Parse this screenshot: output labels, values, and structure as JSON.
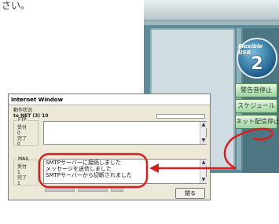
{
  "caption": "さい。",
  "background_app": {
    "logo_text": "Flexible USB",
    "logo_number": "2",
    "buttons": [
      "警告音停止",
      "スケジュール",
      "ネット配信停止"
    ]
  },
  "internet_window": {
    "title": "Internet Window",
    "status_heading": "動作状況",
    "status_line": "to NET (3)  10",
    "ftp": {
      "legend": "FTP",
      "sent_label": "受付",
      "sent_value": "0",
      "done_label": "完了",
      "done_value": "0"
    },
    "mail": {
      "legend": "MAIL",
      "sent_label": "受付",
      "sent_value": "1",
      "done_label": "完了",
      "done_value": "1"
    },
    "mail_log": [
      "SMTPサーバーに接続しました",
      "メッセージを送信しました",
      "SMTPサーバーから切断されました"
    ],
    "close_label": "閉る"
  },
  "colors": {
    "annotation_red": "#d42020",
    "app_teal": "#5c8b97"
  }
}
